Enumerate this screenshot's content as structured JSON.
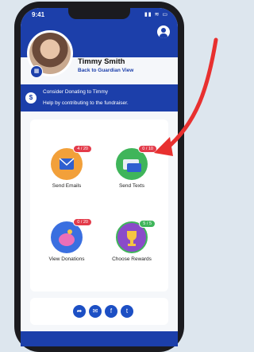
{
  "status": {
    "time": "9:41",
    "icons": "▮▮ ≋ ▭"
  },
  "profile": {
    "name": "Timmy Smith",
    "back_link": "Back to Guardian View"
  },
  "banner": {
    "title": "Consider Donating to Timmy",
    "subtitle": "Help by contributing to the fundraiser."
  },
  "tiles": [
    {
      "label": "Send Emails",
      "badge": "4 / 20"
    },
    {
      "label": "Send Texts",
      "badge": "0 / 10"
    },
    {
      "label": "View Donations",
      "badge": "0 / 20"
    },
    {
      "label": "Choose Rewards",
      "badge": "5 / 5"
    }
  ],
  "colors": {
    "primary": "#1c3faa",
    "badge": "#e33b4a",
    "arrow": "#e8302f"
  },
  "icons": [
    "account-icon",
    "dollar-icon",
    "email-icon",
    "sms-icon",
    "piggy-bank-icon",
    "trophy-icon",
    "share-icon",
    "messenger-icon",
    "facebook-icon",
    "twitter-icon"
  ]
}
